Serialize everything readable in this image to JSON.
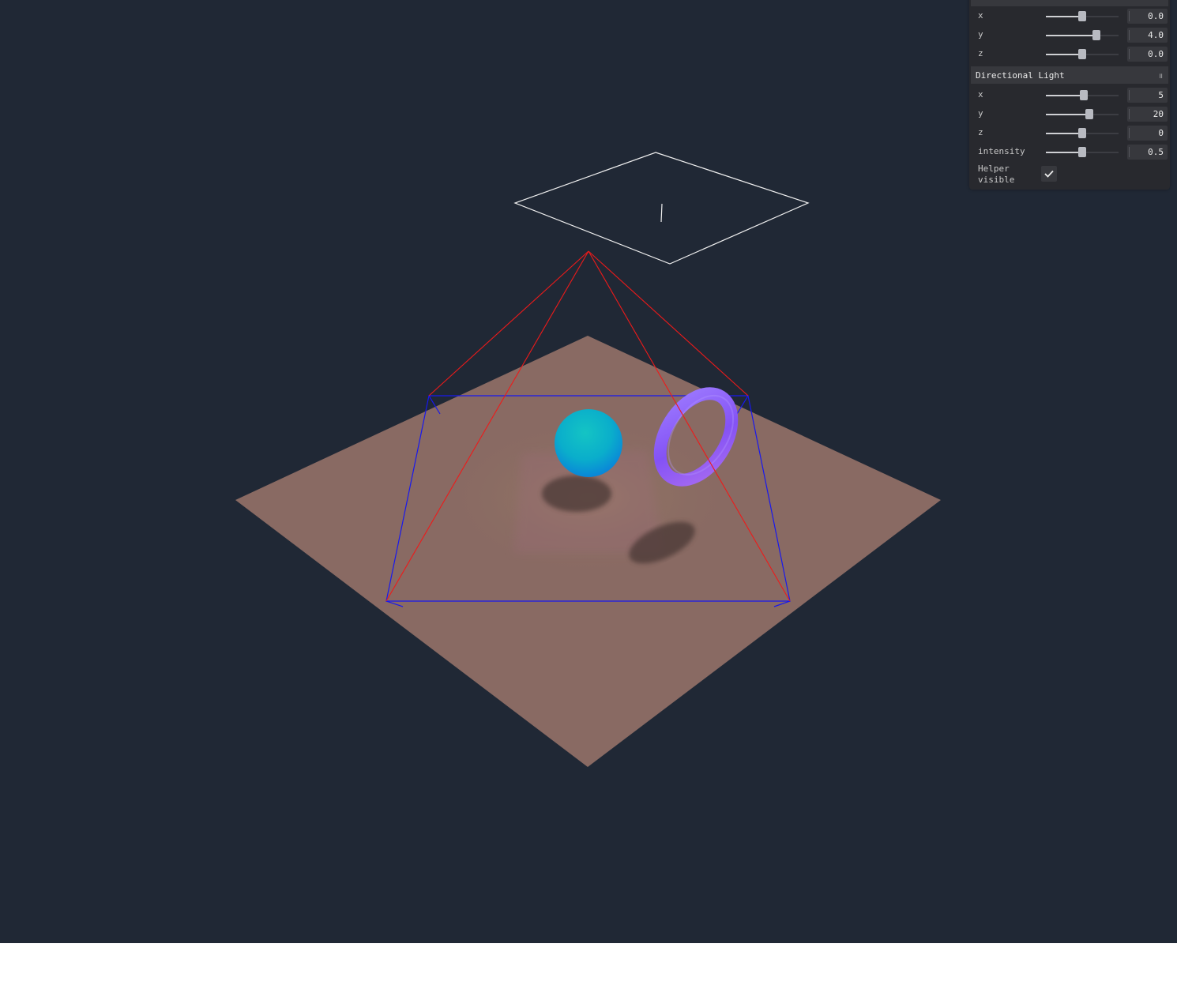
{
  "viewport": {
    "background": "#202835",
    "objects": [
      "ground-plane",
      "sphere",
      "torus",
      "spot-light-cone-helper",
      "directional-light-helper",
      "camera-frustum-helper"
    ],
    "colors": {
      "plane": "#896a63",
      "sphere": "#0fb5c4",
      "torus": "#8b5cf6",
      "cone_helper": "#ff2020",
      "frustum_helper": "#1a1aff",
      "directional_helper": "#ffffff"
    }
  },
  "gui": {
    "position_folder": {
      "rows": [
        {
          "label": "x",
          "value": "0.0",
          "fraction": 0.5
        },
        {
          "label": "y",
          "value": "4.0",
          "fraction": 0.7
        },
        {
          "label": "z",
          "value": "0.0",
          "fraction": 0.5
        }
      ]
    },
    "directional_folder": {
      "title": "Directional Light",
      "toggle_icon": "drag-handle-icon",
      "rows": [
        {
          "label": "x",
          "value": "5",
          "fraction": 0.52
        },
        {
          "label": "y",
          "value": "20",
          "fraction": 0.6
        },
        {
          "label": "z",
          "value": "0",
          "fraction": 0.5
        },
        {
          "label": "intensity",
          "value": "0.5",
          "fraction": 0.5
        }
      ],
      "helper_visible": {
        "label_line1": "Helper",
        "label_line2": "visible",
        "checked": true
      }
    }
  }
}
